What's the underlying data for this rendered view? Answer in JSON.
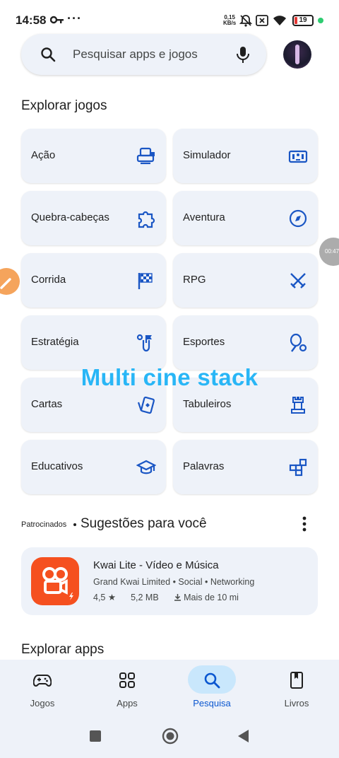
{
  "status_bar": {
    "time": "14:58",
    "more": "···",
    "speed_value": "0,15",
    "speed_unit": "KB/s",
    "battery": "19"
  },
  "search": {
    "placeholder": "Pesquisar apps e jogos"
  },
  "explore_games": {
    "title": "Explorar jogos",
    "categories": [
      {
        "label": "Ação",
        "icon": "game-controller-icon"
      },
      {
        "label": "Simulador",
        "icon": "simulator-icon"
      },
      {
        "label": "Quebra-cabeças",
        "icon": "puzzle-icon"
      },
      {
        "label": "Aventura",
        "icon": "compass-icon"
      },
      {
        "label": "Corrida",
        "icon": "checkered-flag-icon"
      },
      {
        "label": "RPG",
        "icon": "crossed-swords-icon"
      },
      {
        "label": "Estratégia",
        "icon": "strategy-flag-icon"
      },
      {
        "label": "Esportes",
        "icon": "sports-racket-icon"
      },
      {
        "label": "Cartas",
        "icon": "cards-icon"
      },
      {
        "label": "Tabuleiros",
        "icon": "chess-rook-icon"
      },
      {
        "label": "Educativos",
        "icon": "graduation-cap-icon"
      },
      {
        "label": "Palavras",
        "icon": "word-blocks-icon"
      }
    ]
  },
  "suggestions": {
    "sponsored": "Patrocinados",
    "title": "Sugestões para você",
    "app": {
      "name": "Kwai Lite - Vídeo e Música",
      "developer": "Grand Kwai Limited",
      "tag1": "Social",
      "tag2": "Networking",
      "rating": "4,5",
      "size": "5,2 MB",
      "downloads": "Mais de 10 mi"
    }
  },
  "explore_apps": {
    "title": "Explorar apps"
  },
  "bottom_nav": {
    "items": [
      {
        "label": "Jogos",
        "icon": "gamepad-icon"
      },
      {
        "label": "Apps",
        "icon": "apps-grid-icon"
      },
      {
        "label": "Pesquisa",
        "icon": "search-icon",
        "active": true
      },
      {
        "label": "Livros",
        "icon": "book-icon"
      }
    ]
  },
  "overlay": {
    "watermark": "Multi cine stack",
    "timer": "00:47"
  },
  "colors": {
    "accent": "#0b57d0",
    "tile_bg": "#eef2f9",
    "icon_blue": "#1a56c4",
    "active_pill": "#c9e7fc",
    "kwai_orange": "#f5501f",
    "watermark": "#29b6f6"
  }
}
